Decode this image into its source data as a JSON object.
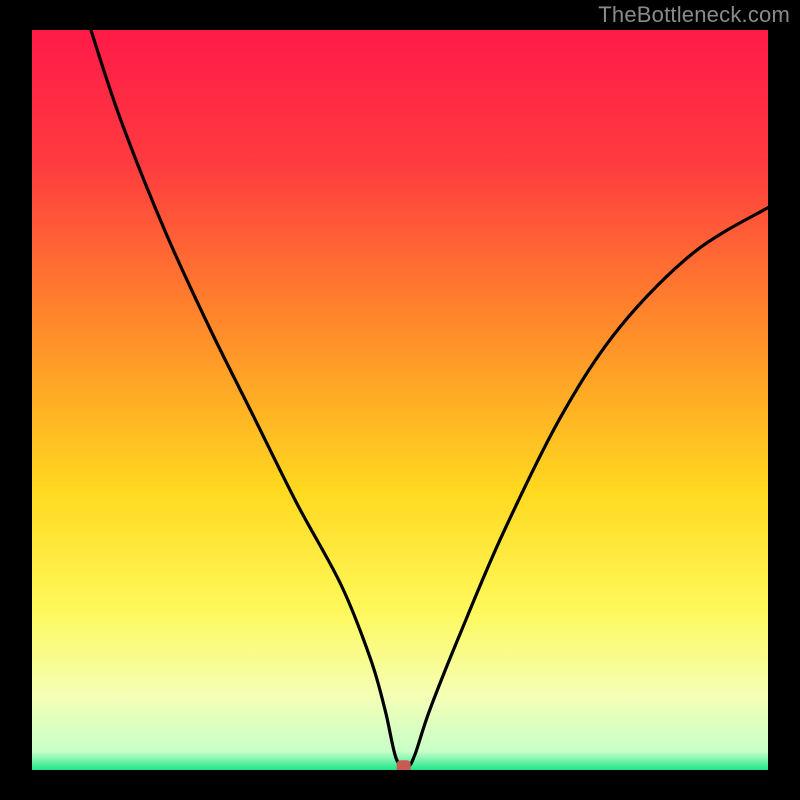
{
  "watermark": "TheBottleneck.com",
  "chart_data": {
    "type": "line",
    "title": "",
    "xlabel": "",
    "ylabel": "",
    "xlim": [
      0,
      100
    ],
    "ylim": [
      0,
      100
    ],
    "background_gradient": [
      {
        "stop": 0.0,
        "color": "#ff1b48"
      },
      {
        "stop": 0.18,
        "color": "#ff3b3f"
      },
      {
        "stop": 0.4,
        "color": "#ff8a2a"
      },
      {
        "stop": 0.62,
        "color": "#ffd81f"
      },
      {
        "stop": 0.78,
        "color": "#fff859"
      },
      {
        "stop": 0.9,
        "color": "#f4ffb5"
      },
      {
        "stop": 0.975,
        "color": "#c8ffc8"
      },
      {
        "stop": 1.0,
        "color": "#1ee68a"
      }
    ],
    "marker": {
      "x": 50.5,
      "y": 0.5,
      "color": "#c85a54"
    },
    "series": [
      {
        "name": "curve",
        "x": [
          8,
          12,
          18,
          24,
          30,
          36,
          42,
          46,
          48,
          49.5,
          51,
          52,
          54,
          58,
          64,
          72,
          80,
          90,
          100
        ],
        "values": [
          100,
          88,
          73,
          60,
          48,
          36,
          25,
          15,
          8,
          1.5,
          0.5,
          2,
          8,
          18,
          32,
          48,
          60,
          70,
          76
        ]
      }
    ]
  }
}
